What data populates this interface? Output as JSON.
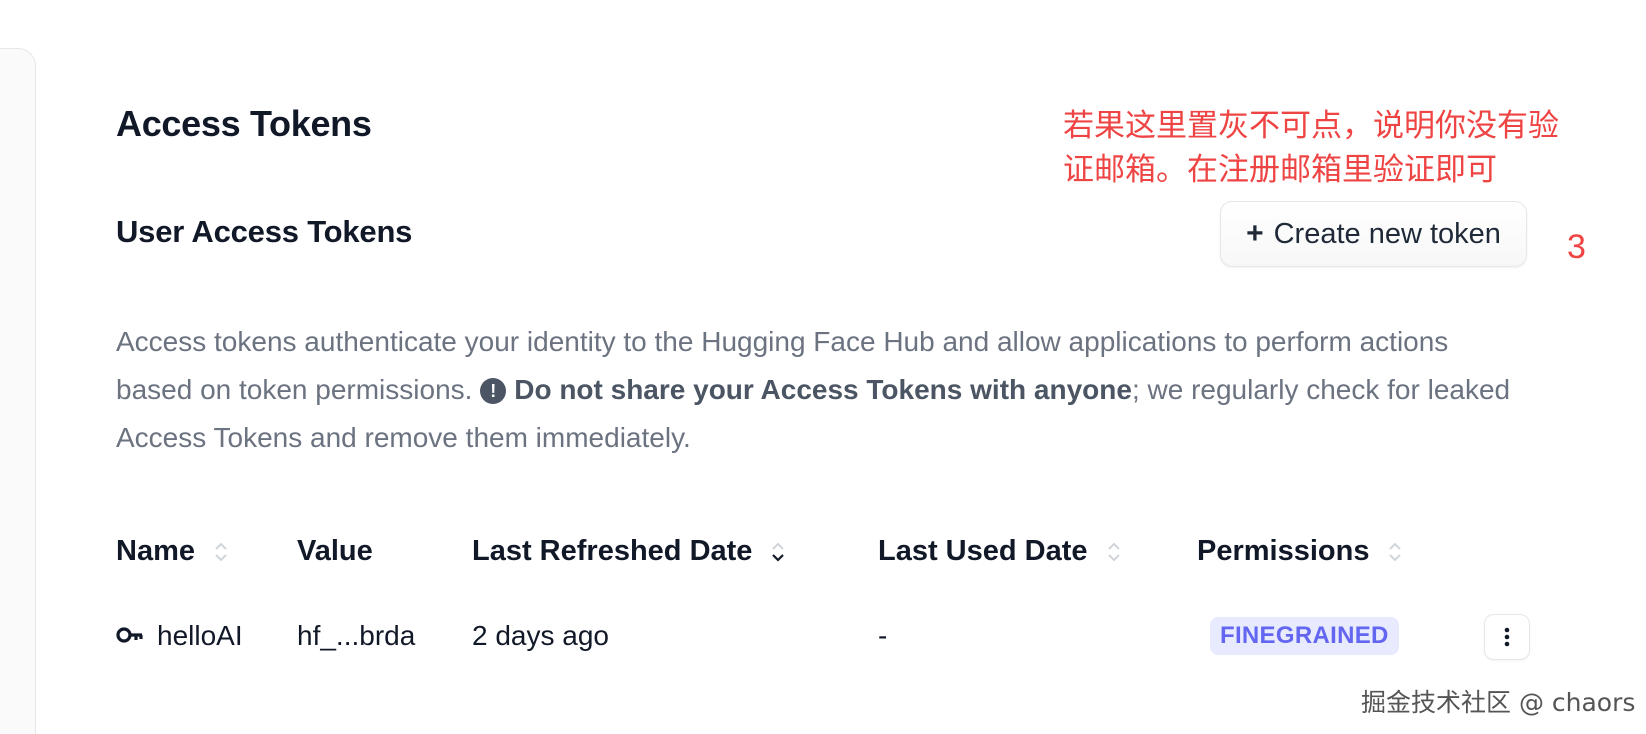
{
  "page": {
    "title": "Access Tokens"
  },
  "section": {
    "title": "User Access Tokens"
  },
  "create_button": {
    "label": "Create new token"
  },
  "description": {
    "part1": "Access tokens authenticate your identity to the Hugging Face Hub and allow applications to perform actions based on token permissions. ",
    "warning_prefix": "Do not share your ",
    "warning_emphasis": "Access Tokens",
    "warning_suffix": " with anyone",
    "part2": "; we regularly check for leaked Access Tokens and remove them immediately."
  },
  "table": {
    "columns": [
      "Name",
      "Value",
      "Last Refreshed Date",
      "Last Used Date",
      "Permissions"
    ],
    "rows": [
      {
        "name": "helloAI",
        "value": "hf_...brda",
        "last_refreshed": "2 days ago",
        "last_used": "-",
        "permissions": "FINEGRAINED"
      }
    ]
  },
  "annotation": {
    "text": "若果这里置灰不可点，说明你没有验证邮箱。在注册邮箱里验证即可",
    "step": "3"
  },
  "watermark": "掘金技术社区 @ chaors",
  "colors": {
    "accent_red": "#ef4444",
    "badge_bg": "#e8eafe",
    "badge_text": "#6366f1"
  }
}
